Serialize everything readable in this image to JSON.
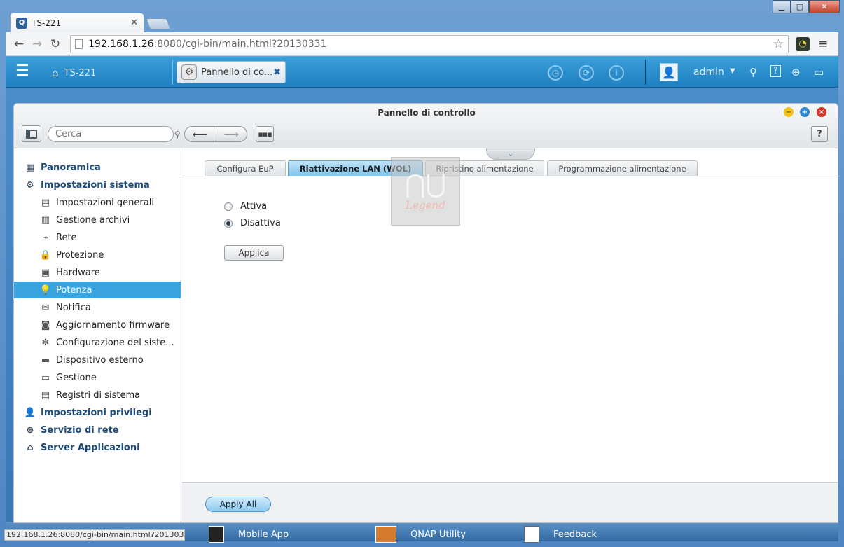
{
  "browser": {
    "tab_title": "TS-221",
    "tab_favicon": "Q",
    "url_host": "192.168.1.26",
    "url_rest": ":8080/cgi-bin/main.html?20130331",
    "status_url": "192.168.1.26:8080/cgi-bin/main.html?20130331#"
  },
  "qnap_bar": {
    "home_label": "TS-221",
    "app_tab_label": "Pannello di co...",
    "user_name": "admin"
  },
  "window": {
    "title": "Pannello di controllo",
    "search_placeholder": "Cerca",
    "help_label": "?"
  },
  "sidebar": {
    "items": [
      {
        "label": "Panoramica",
        "icon": "grid-icon"
      },
      {
        "label": "Impostazioni sistema",
        "icon": "gear-icon"
      },
      {
        "label": "Impostazioni generali",
        "icon": "settings-doc-icon"
      },
      {
        "label": "Gestione archivi",
        "icon": "storage-icon"
      },
      {
        "label": "Rete",
        "icon": "network-icon"
      },
      {
        "label": "Protezione",
        "icon": "lock-icon"
      },
      {
        "label": "Hardware",
        "icon": "hardware-icon"
      },
      {
        "label": "Potenza",
        "icon": "bulb-icon"
      },
      {
        "label": "Notifica",
        "icon": "notification-icon"
      },
      {
        "label": "Aggiornamento firmware",
        "icon": "firmware-icon"
      },
      {
        "label": "Configurazione del siste...",
        "icon": "config-icon"
      },
      {
        "label": "Dispositivo esterno",
        "icon": "external-device-icon"
      },
      {
        "label": "Gestione",
        "icon": "monitor-icon"
      },
      {
        "label": "Registri di sistema",
        "icon": "log-icon"
      },
      {
        "label": "Impostazioni privilegi",
        "icon": "user-icon"
      },
      {
        "label": "Servizio di rete",
        "icon": "globe-icon"
      },
      {
        "label": "Server Applicazioni",
        "icon": "app-server-icon"
      }
    ]
  },
  "tabs": [
    {
      "label": "Configura EuP"
    },
    {
      "label": "Riattivazione LAN (WOL)"
    },
    {
      "label": "Ripristino alimentazione"
    },
    {
      "label": "Programmazione alimentazione"
    }
  ],
  "form": {
    "option_on": "Attiva",
    "option_off": "Disattiva",
    "apply_label": "Applica",
    "apply_all_label": "Apply All"
  },
  "watermark": {
    "text": "Legend"
  },
  "dock": {
    "item1": "Mobile App",
    "item2": "QNAP Utility",
    "item3": "Feedback"
  }
}
